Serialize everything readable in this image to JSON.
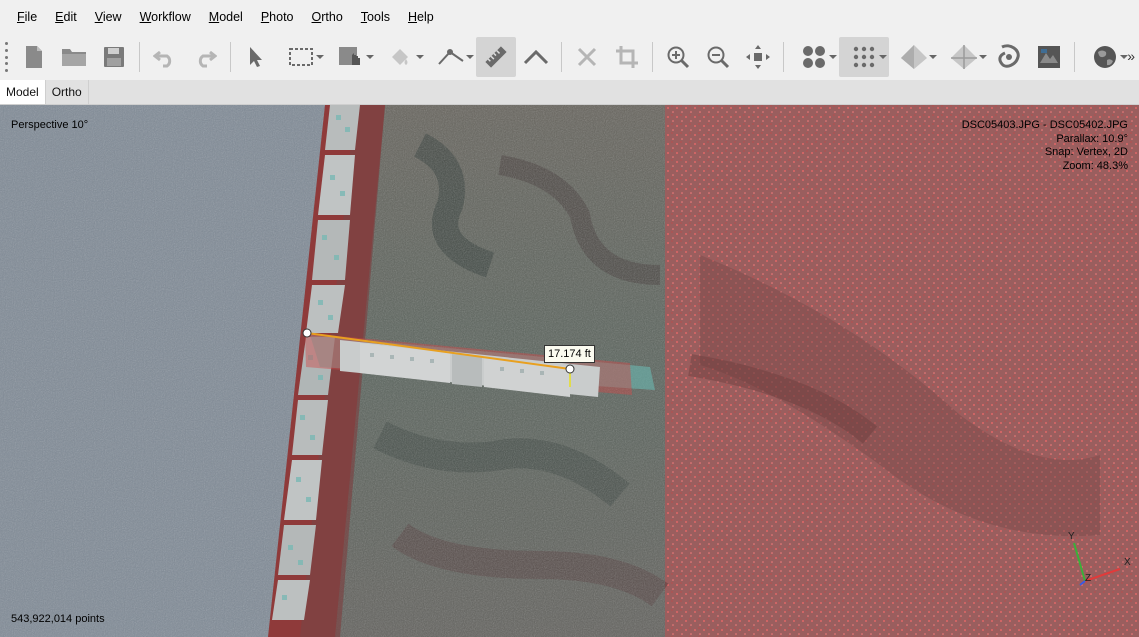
{
  "menu": {
    "items": [
      {
        "key": "F",
        "rest": "ile"
      },
      {
        "key": "E",
        "rest": "dit"
      },
      {
        "key": "V",
        "rest": "iew"
      },
      {
        "key": "W",
        "rest": "orkflow"
      },
      {
        "key": "M",
        "rest": "odel"
      },
      {
        "key": "P",
        "rest": "hoto"
      },
      {
        "key": "O",
        "rest": "rtho"
      },
      {
        "key": "T",
        "rest": "ools"
      },
      {
        "key": "H",
        "rest": "elp"
      }
    ]
  },
  "toolbar": {
    "icons": [
      "new-document-icon",
      "open-folder-icon",
      "save-icon",
      "undo-icon",
      "redo-icon",
      "navigation-arrow-icon",
      "rectangle-selection-icon",
      "draw-shape-icon",
      "paint-fill-icon",
      "polyline-tool-icon",
      "ruler-icon",
      "angle-tool-icon",
      "delete-icon",
      "crop-icon",
      "zoom-in-icon",
      "zoom-out-icon",
      "reset-view-icon",
      "point-cloud-icon",
      "dense-cloud-icon",
      "model-solid-icon",
      "model-textured-icon",
      "tiled-model-icon",
      "dem-icon",
      "globe-icon"
    ],
    "overflow": "»"
  },
  "tabs": [
    {
      "label": "Model",
      "active": true
    },
    {
      "label": "Ortho",
      "active": false
    }
  ],
  "viewport": {
    "projection": "Perspective 10°",
    "info_lines": [
      "DSC05403.JPG - DSC05402.JPG",
      "Parallax: 10.9°",
      "Snap: Vertex, 2D",
      "Zoom: 48.3%"
    ],
    "point_count": "543,922,014 points",
    "measurement": "17.174 ft",
    "axes": {
      "x": "X",
      "y": "Y",
      "z": "Z"
    }
  },
  "colors": {
    "measure_line": "#e8a020",
    "anaglyph_red": "#c84a4a",
    "anaglyph_cyan": "#4fa8a0",
    "sky": "#7f8a96"
  }
}
